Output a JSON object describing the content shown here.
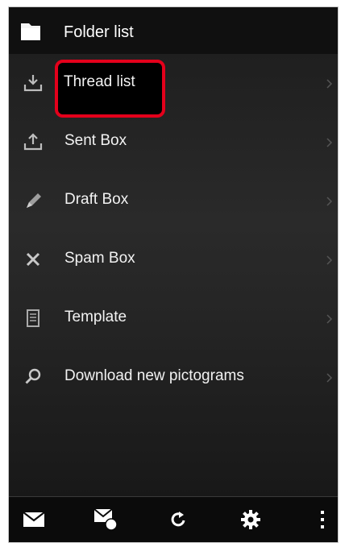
{
  "header": {
    "title": "Folder list",
    "icon": "folder-icon"
  },
  "menu": {
    "items": [
      {
        "label": "Thread list",
        "icon": "inbox-download-icon",
        "highlighted": true
      },
      {
        "label": "Sent Box",
        "icon": "outbox-upload-icon"
      },
      {
        "label": "Draft Box",
        "icon": "pencil-icon"
      },
      {
        "label": "Spam Box",
        "icon": "close-x-icon"
      },
      {
        "label": "Template",
        "icon": "document-icon"
      },
      {
        "label": "Download new pictograms",
        "icon": "search-icon"
      }
    ]
  },
  "toolbar": {
    "buttons": [
      "compose-mail-icon",
      "mail-settings-icon",
      "refresh-icon",
      "gear-icon",
      "overflow-menu-icon"
    ]
  },
  "colors": {
    "highlight": "#e4001b",
    "background": "#222222",
    "text": "#f2f2f2"
  }
}
